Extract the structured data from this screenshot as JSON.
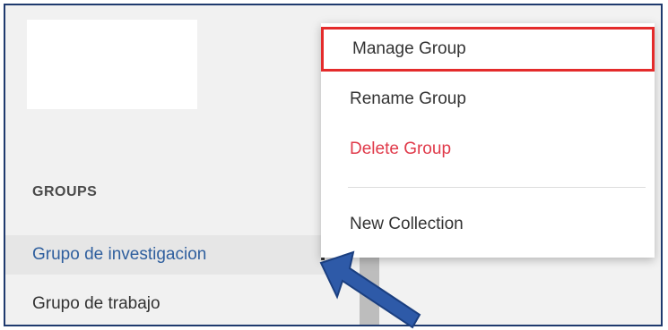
{
  "sidebar": {
    "groups_heading": "GROUPS",
    "groups": [
      {
        "label": "Grupo de investigacion",
        "active": true
      },
      {
        "label": "Grupo de trabajo",
        "active": false
      }
    ],
    "kebab_glyph": "⋮"
  },
  "context_menu": {
    "items": [
      {
        "label": "Manage Group",
        "highlighted": true
      },
      {
        "label": "Rename Group"
      },
      {
        "label": "Delete Group",
        "destructive": true
      },
      {
        "label": "New Collection"
      }
    ]
  },
  "colors": {
    "highlight_border": "#e42b2b",
    "delete_text": "#e03a4a",
    "active_group_text": "#2f5f9e",
    "annotation_arrow": "#2e5aa8"
  }
}
